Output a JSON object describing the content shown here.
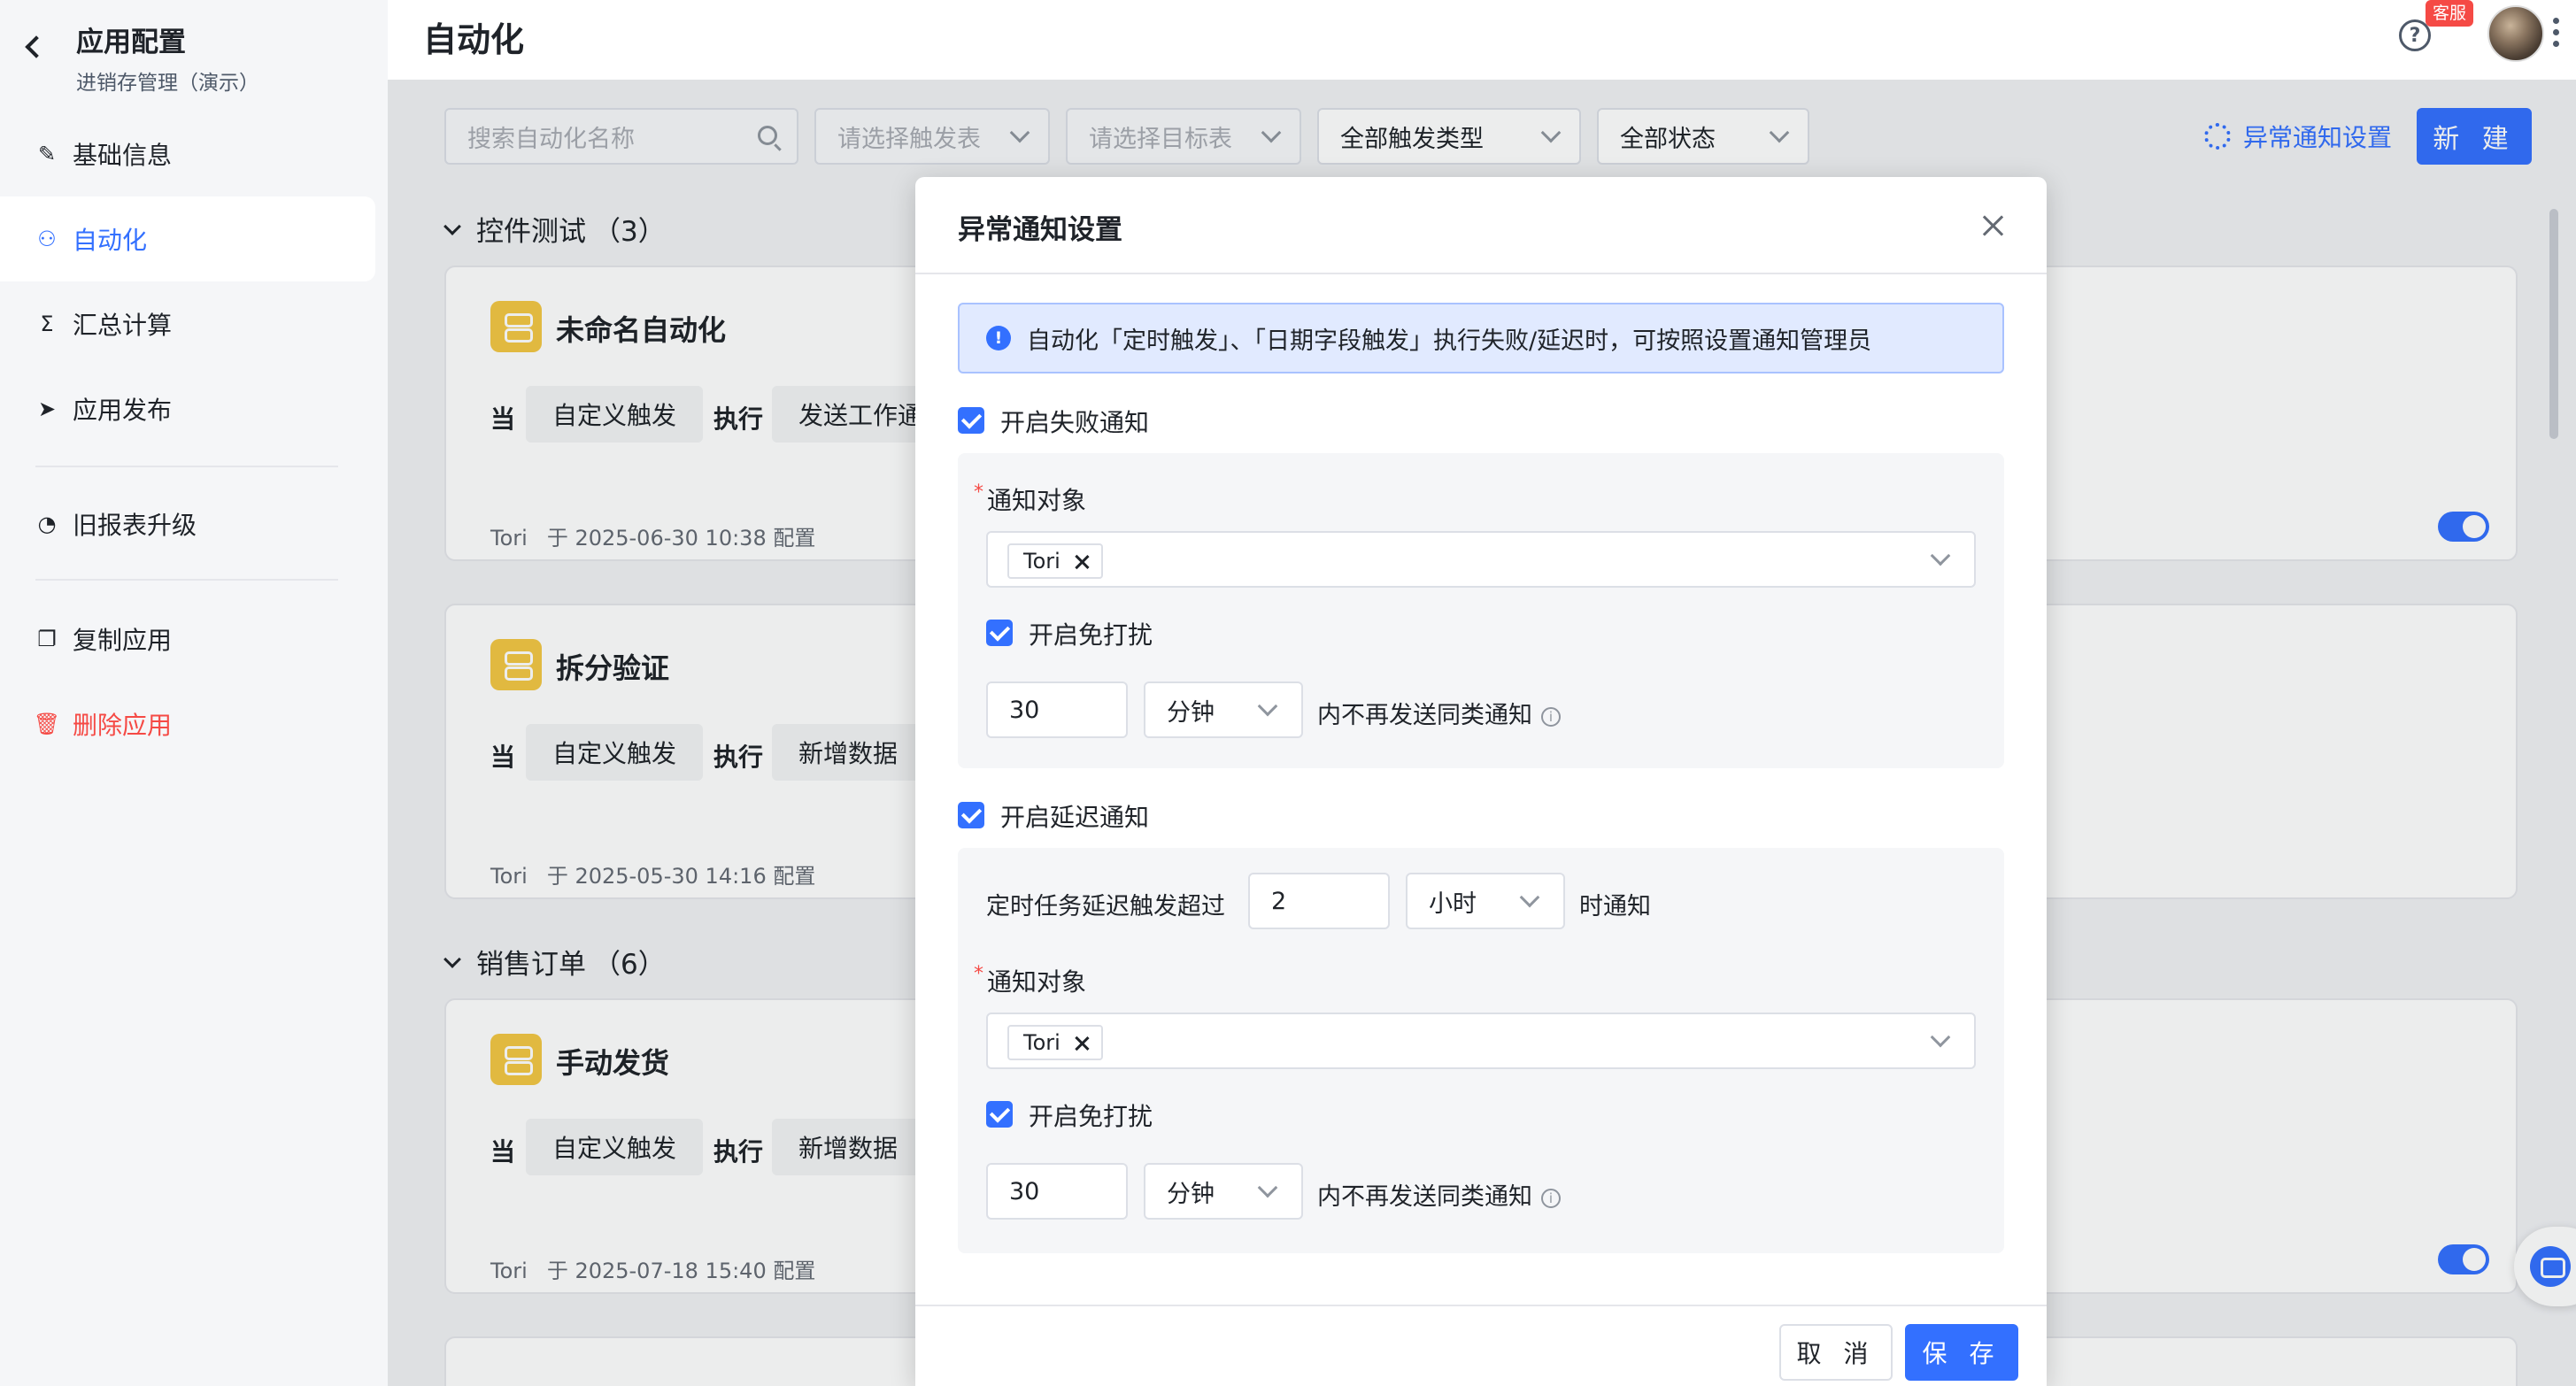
{
  "sidebar": {
    "title": "应用配置",
    "subtitle": "进销存管理（演示）",
    "items": [
      {
        "label": "基础信息",
        "icon": "edit-icon"
      },
      {
        "label": "自动化",
        "icon": "flow-icon"
      },
      {
        "label": "汇总计算",
        "icon": "sigma-icon"
      },
      {
        "label": "应用发布",
        "icon": "send-icon"
      },
      {
        "label": "旧报表升级",
        "icon": "chart-pie-icon"
      },
      {
        "label": "复制应用",
        "icon": "copy-icon"
      },
      {
        "label": "删除应用",
        "icon": "trash-icon"
      }
    ]
  },
  "header": {
    "title": "自动化",
    "help_glyph": "?",
    "support_badge": "客服"
  },
  "toolbar": {
    "search_placeholder": "搜索自动化名称",
    "trigger_table_placeholder": "请选择触发表",
    "target_table_placeholder": "请选择目标表",
    "trigger_type": "全部触发类型",
    "status": "全部状态",
    "notify_settings": "异常通知设置",
    "new_button": "新 建"
  },
  "groups": [
    {
      "name": "控件测试",
      "count": "（3）",
      "cards": [
        {
          "name": "未命名自动化",
          "when": "当",
          "trigger": "自定义触发",
          "exec": "执行",
          "action": "发送工作通",
          "user": "Tori",
          "time": "于 2025-06-30 10:38 配置",
          "enabled": true
        },
        {
          "name": "拆分验证",
          "when": "当",
          "trigger": "自定义触发",
          "exec": "执行",
          "action": "新增数据",
          "user": "Tori",
          "time": "于 2025-05-30 14:16 配置",
          "enabled": false
        }
      ]
    },
    {
      "name": "销售订单",
      "count": "（6）",
      "cards": [
        {
          "name": "手动发货",
          "when": "当",
          "trigger": "自定义触发",
          "exec": "执行",
          "action": "新增数据",
          "user": "Tori",
          "time": "于 2025-07-18 15:40 配置",
          "enabled": true
        }
      ]
    }
  ],
  "modal": {
    "title": "异常通知设置",
    "info_glyph": "!",
    "alert": "自动化「定时触发」、「日期字段触发」执行失败/延迟时，可按照设置通知管理员",
    "failure": {
      "checkbox_label": "开启失败通知",
      "target_label": "通知对象",
      "target_tag": "Tori",
      "dnd_label": "开启免打扰",
      "dnd_value": "30",
      "dnd_unit": "分钟",
      "dnd_suffix": "内不再发送同类通知"
    },
    "delay": {
      "checkbox_label": "开启延迟通知",
      "threshold_prefix": "定时任务延迟触发超过",
      "threshold_value": "2",
      "threshold_unit": "小时",
      "threshold_suffix": "时通知",
      "target_label": "通知对象",
      "target_tag": "Tori",
      "dnd_label": "开启免打扰",
      "dnd_value": "30",
      "dnd_unit": "分钟",
      "dnd_suffix": "内不再发送同类通知"
    },
    "cancel": "取 消",
    "save": "保 存"
  },
  "colors": {
    "accent": "#3370ff",
    "danger": "#f54a45",
    "card_icon": "#f3c744"
  }
}
